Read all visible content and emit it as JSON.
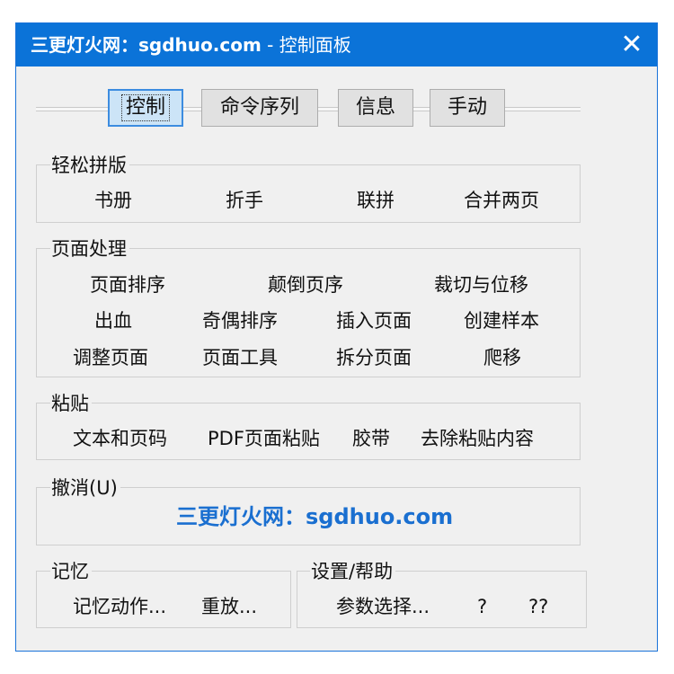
{
  "window": {
    "title_site": "三更灯火网：sgdhuo.com",
    "title_sep": " - ",
    "title_panel": "控制面板",
    "close_glyph": "✕"
  },
  "tabs": [
    {
      "label": "控制",
      "active": true
    },
    {
      "label": "命令序列"
    },
    {
      "label": "信息"
    },
    {
      "label": "手动"
    }
  ],
  "groups": {
    "easy_imposition": {
      "label": "轻松拼版",
      "items": [
        "书册",
        "折手",
        "联拼",
        "合并两页"
      ]
    },
    "page_processing": {
      "label": "页面处理",
      "items": [
        "页面排序",
        "颠倒页序",
        "裁切与位移",
        "出血",
        "奇偶排序",
        "插入页面",
        "创建样本",
        "调整页面",
        "页面工具",
        "拆分页面",
        "爬移"
      ]
    },
    "paste": {
      "label": "粘贴",
      "items": [
        "文本和页码",
        "PDF页面粘贴",
        "胶带",
        "去除粘贴内容"
      ]
    },
    "undo": {
      "label": "撤消(U)",
      "watermark": "三更灯火网：sgdhuo.com"
    },
    "memory": {
      "label": "记忆",
      "items": [
        "记忆动作...",
        "重放..."
      ]
    },
    "settings": {
      "label": "设置/帮助",
      "items": [
        "参数选择...",
        "?",
        "??"
      ]
    }
  },
  "colors": {
    "title_bar": "#0b73d8",
    "active_tab": "#cce4f7",
    "watermark": "#1a6fd0"
  }
}
